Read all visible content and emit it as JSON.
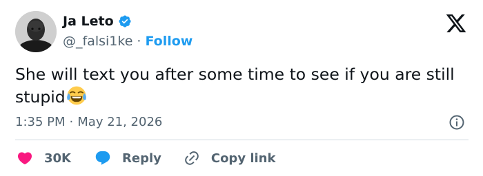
{
  "author": {
    "display_name": "Ja Leto",
    "handle": "@_falsi1ke",
    "separator": "·",
    "follow_label": "Follow",
    "verified_color": "#1d9bf0"
  },
  "tweet": {
    "text": "She will text you after some time to see if you are still stupid",
    "emoji": "crying-laughing-emoji"
  },
  "timestamp": {
    "time": "1:35 PM",
    "separator": "·",
    "date": "May 21, 2026"
  },
  "actions": {
    "like_count": "30K",
    "reply_label": "Reply",
    "copy_link_label": "Copy link"
  },
  "colors": {
    "like": "#f91880",
    "reply": "#1d9bf0",
    "secondary_text": "#536471",
    "primary_text": "#0f1419"
  },
  "icons": [
    "verified-badge-icon",
    "x-logo-icon",
    "info-icon",
    "heart-icon",
    "reply-bubble-icon",
    "link-icon"
  ]
}
